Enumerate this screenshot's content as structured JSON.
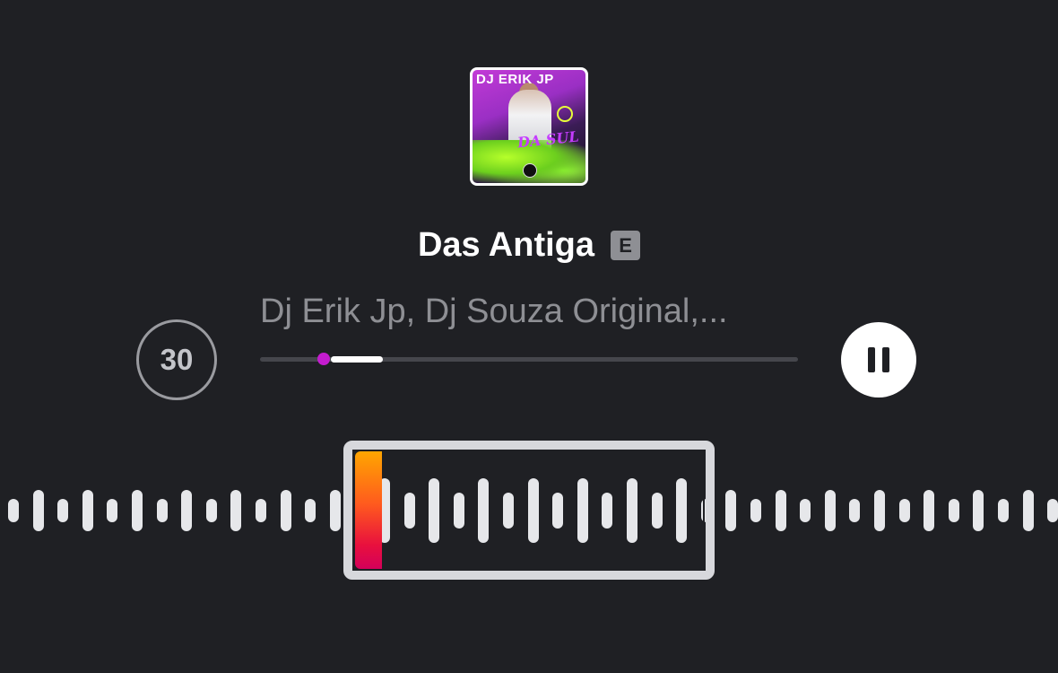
{
  "track": {
    "title": "Das Antiga",
    "explicit_label": "E",
    "artists": "Dj Erik Jp, Dj Souza Original,..."
  },
  "album_art": {
    "title_text": "DJ ERIK JP",
    "script_text": "DA SUL"
  },
  "controls": {
    "skip_back_label": "30",
    "pause_icon": "pause-icon",
    "progress_fraction": 0.13
  },
  "colors": {
    "background": "#1f2024",
    "accent_knob": "#c41ccf",
    "secondary_text": "#8e8f94",
    "waveform": "#e6e7ea",
    "selection_frame": "#d7d8dc",
    "playhead_gradient": [
      "#ffa600",
      "#ff5a1e",
      "#e8103e",
      "#d4005a"
    ]
  }
}
